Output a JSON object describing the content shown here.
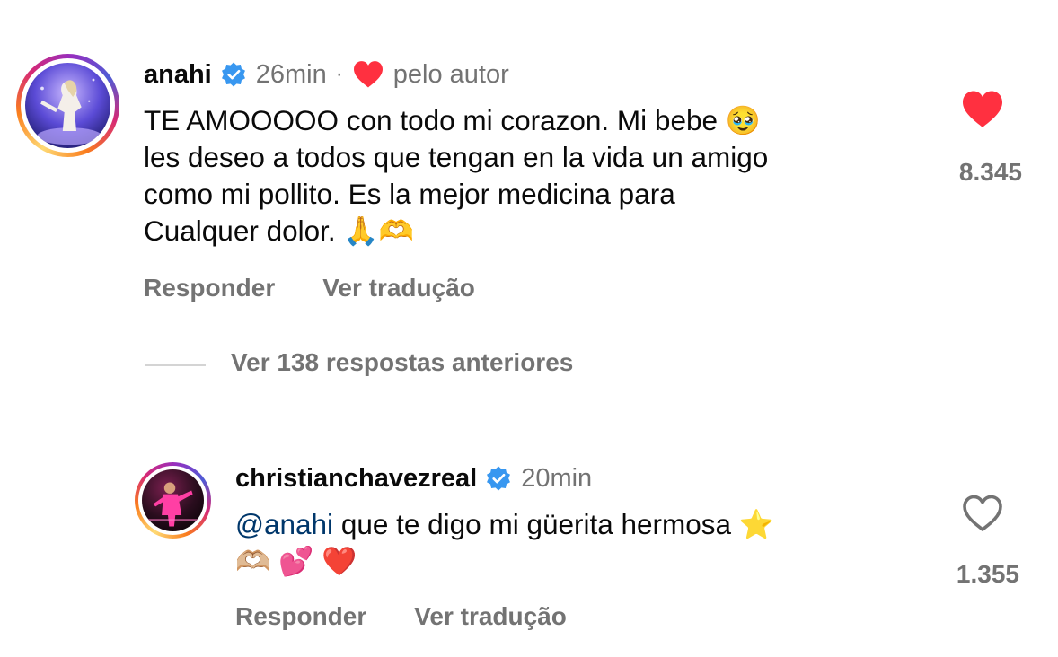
{
  "comments": [
    {
      "username": "anahi",
      "verified_icon": "verified-badge-icon",
      "time": "26min",
      "separator": "·",
      "liked_by_author_label": "pelo autor",
      "text_lines": [
        "TE AMOOOOO con todo mi corazon. Mi bebe 🥹",
        "les deseo a todos que tengan en la vida un amigo",
        "como mi pollito.  Es la mejor medicina para",
        "Cualquer dolor. 🙏🫶"
      ],
      "like_count": "8.345",
      "liked": true,
      "actions": {
        "reply": "Responder",
        "translate": "Ver tradução"
      }
    },
    {
      "username": "christianchavezreal",
      "verified_icon": "verified-badge-icon",
      "time": "20min",
      "mention": "@anahi",
      "text_line_1": " que te digo mi güerita hermosa ⭐️",
      "text_line_2": "🫶🏼 💕 ❤️",
      "like_count": "1.355",
      "liked": false,
      "actions": {
        "reply": "Responder",
        "translate": "Ver tradução"
      }
    }
  ],
  "view_replies_label": "Ver 138 respostas anteriores",
  "colors": {
    "like_red": "#ff3040",
    "verified_blue": "#0095f6",
    "secondary_text": "#737373",
    "mention": "#00376b"
  }
}
